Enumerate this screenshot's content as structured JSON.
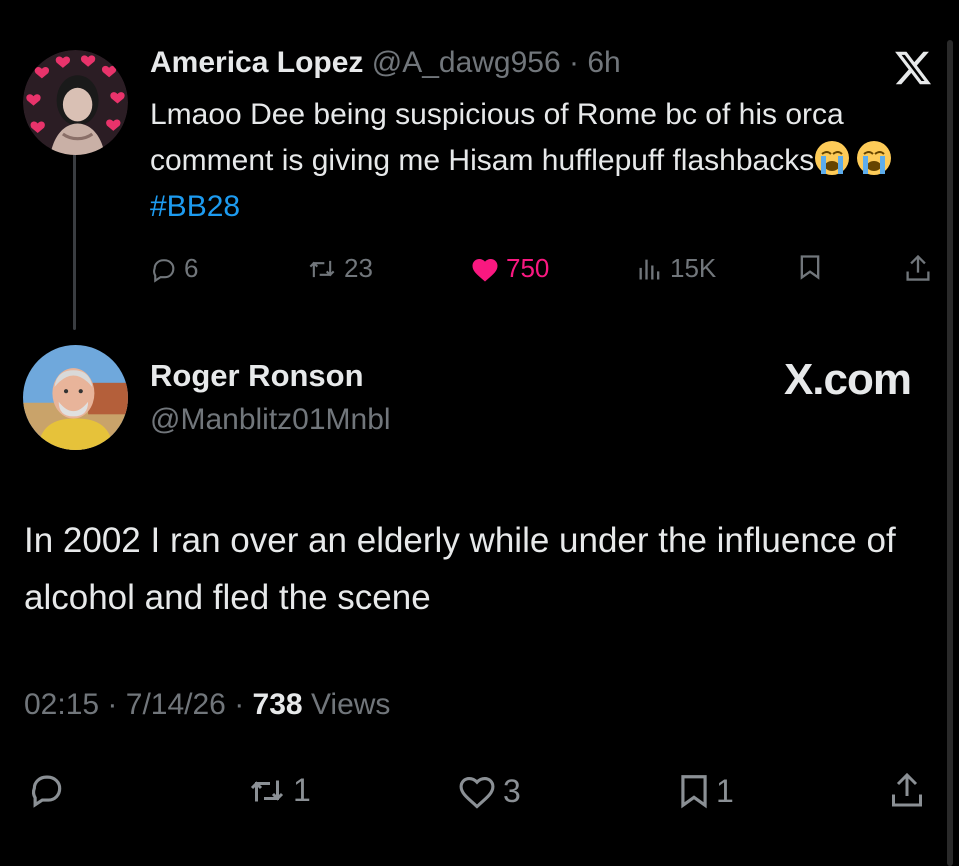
{
  "tweet": {
    "author_name": "America Lopez",
    "author_handle": "@A_dawg956",
    "separator": "·",
    "age": "6h",
    "text_main": "Lmaoo Dee being suspicious of Rome bc of his orca comment is giving me Hisam hufflepuff flashbacks",
    "emoji": [
      "loudly-crying-face",
      "loudly-crying-face"
    ],
    "hashtag": "#BB28",
    "actions": {
      "replies": "6",
      "reposts": "23",
      "likes": "750",
      "views": "15K"
    }
  },
  "reply": {
    "author_name": "Roger Ronson",
    "author_handle": "@Manblitz01Mnbl",
    "brand": "X.com",
    "text": "In 2002 I ran over an elderly while under the influence of alcohol and fled the scene",
    "time": "02:15",
    "sep1": "·",
    "date": "7/14/26",
    "sep2": "·",
    "views_count": "738",
    "views_label": "Views",
    "actions": {
      "replies": "",
      "reposts": "1",
      "likes": "3",
      "bookmarks": "1"
    }
  },
  "colors": {
    "background": "#000000",
    "text": "#e7e9ea",
    "muted": "#71767b",
    "hashtag": "#1d9bf0",
    "like": "#f91880"
  }
}
